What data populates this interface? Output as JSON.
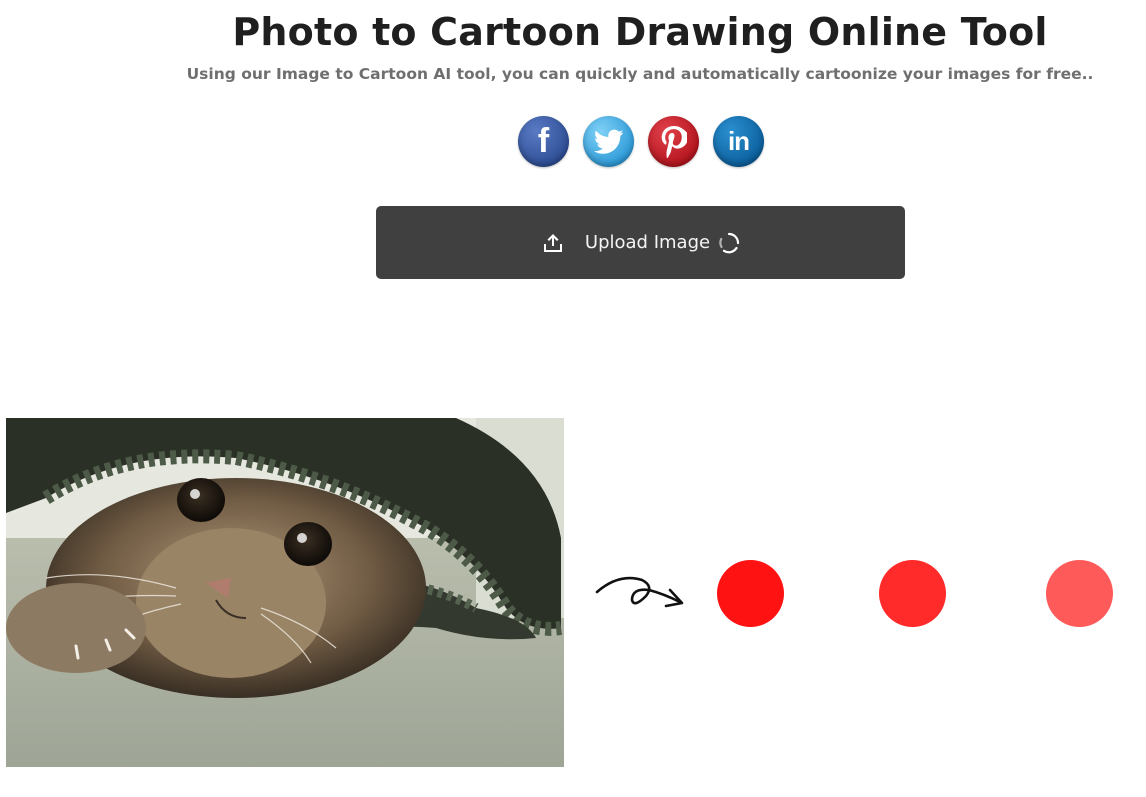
{
  "header": {
    "title": "Photo to Cartoon Drawing Online Tool",
    "subtitle": "Using our Image to Cartoon AI tool, you can quickly and automatically cartoonize your images for free.."
  },
  "share": [
    {
      "network": "facebook",
      "glyph": "f",
      "color": "#3b5998"
    },
    {
      "network": "twitter",
      "glyph": "bird",
      "color": "#2d9ad8"
    },
    {
      "network": "pinterest",
      "glyph": "P",
      "color": "#c8232c"
    },
    {
      "network": "linkedin",
      "glyph": "in",
      "color": "#0e76a8"
    }
  ],
  "upload": {
    "label": "Upload Image",
    "icon": "upload-icon",
    "loading": true,
    "background": "#404040"
  },
  "preview": {
    "arrow_icon": "curved-arrow-icon",
    "loading_dots": [
      "#ff1212",
      "#ff2a2a",
      "#ff5a5a"
    ]
  }
}
